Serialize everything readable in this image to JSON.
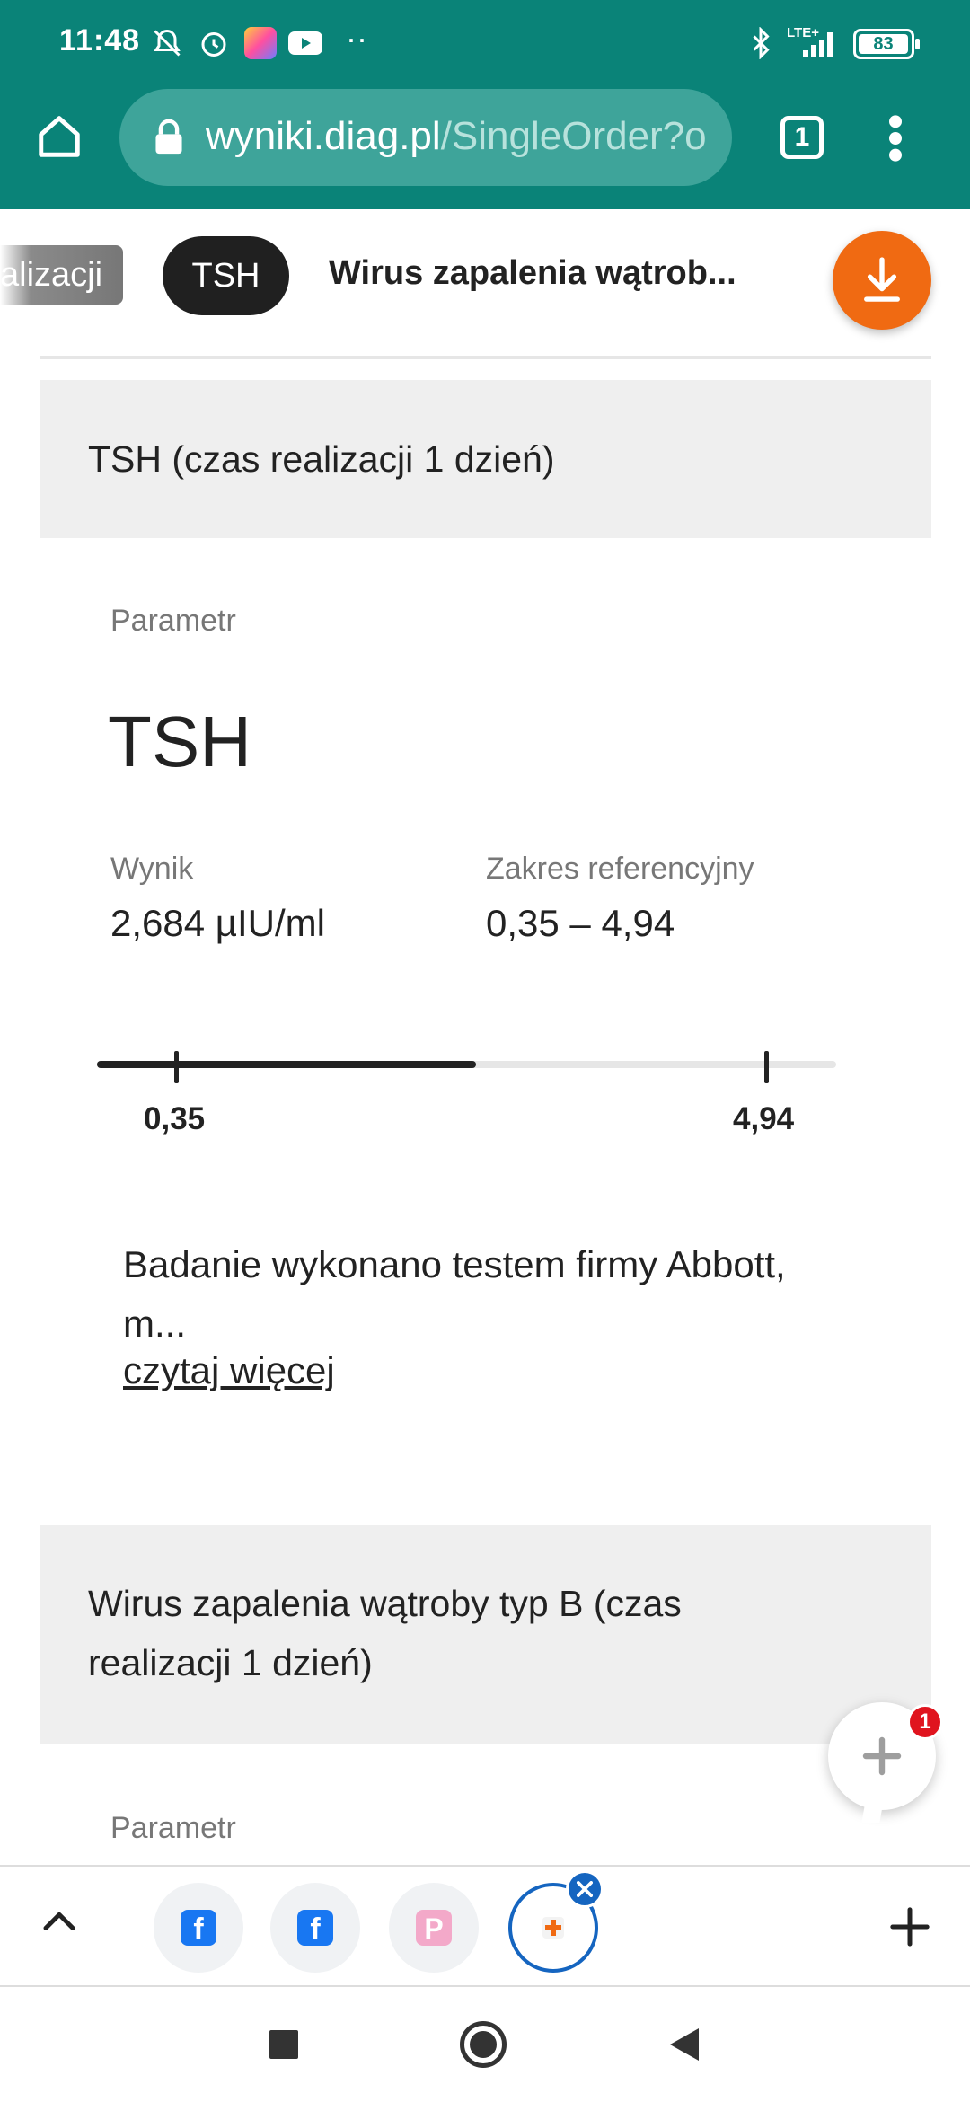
{
  "status_bar": {
    "time": "11:48",
    "battery": "83",
    "network": "LTE+"
  },
  "browser": {
    "url_host": "wyniki.diag.pl",
    "url_path": "/SingleOrder?or",
    "tab_count": "1"
  },
  "chips": {
    "partial": "alizacji",
    "active": "TSH",
    "next": "Wirus zapalenia wątrob..."
  },
  "sections": {
    "tsh": {
      "title": "TSH (czas realizacji 1 dzień)",
      "param_label": "Parametr",
      "param_name": "TSH",
      "result_label": "Wynik",
      "result_value": "2,684 µIU/ml",
      "range_label": "Zakres referencyjny",
      "range_value": "0,35 – 4,94",
      "range_low": "0,35",
      "range_high": "4,94",
      "result_numeric": 2.684,
      "note": "Badanie wykonano testem firmy Abbott, m...",
      "read_more": "czytaj więcej"
    },
    "hbv": {
      "title_line1": "Wirus zapalenia wątroby typ B (czas",
      "title_line2": "realizacji 1 dzień)",
      "param_label": "Parametr"
    }
  },
  "fab": {
    "badge": "1"
  },
  "colors": {
    "toolbar": "#0a8378",
    "accent": "#f06a12",
    "chip_active": "#202020"
  }
}
